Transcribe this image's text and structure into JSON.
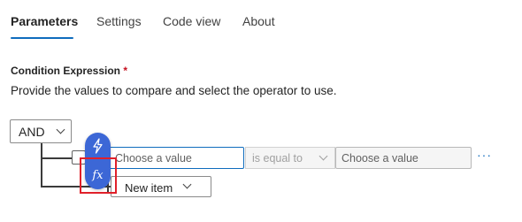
{
  "tabs": [
    {
      "label": "Parameters",
      "active": true
    },
    {
      "label": "Settings",
      "active": false
    },
    {
      "label": "Code view",
      "active": false
    },
    {
      "label": "About",
      "active": false
    }
  ],
  "condition": {
    "label": "Condition Expression",
    "required_marker": "*",
    "description": "Provide the values to compare and select the operator to use."
  },
  "group": {
    "operator_selected": "AND"
  },
  "row": {
    "left_placeholder": "Choose a value",
    "operator_selected": "is equal to",
    "right_placeholder": "Choose a value",
    "more_label": "···"
  },
  "insert_menu": {
    "dynamic_content_icon": "lightning-icon",
    "expression_icon": "fx-icon",
    "fx_label": "fx"
  },
  "new_item": {
    "label": "New item"
  },
  "colors": {
    "accent": "#0f6cbd",
    "fab_background": "#3c67d6",
    "highlight": "#e0202a"
  }
}
